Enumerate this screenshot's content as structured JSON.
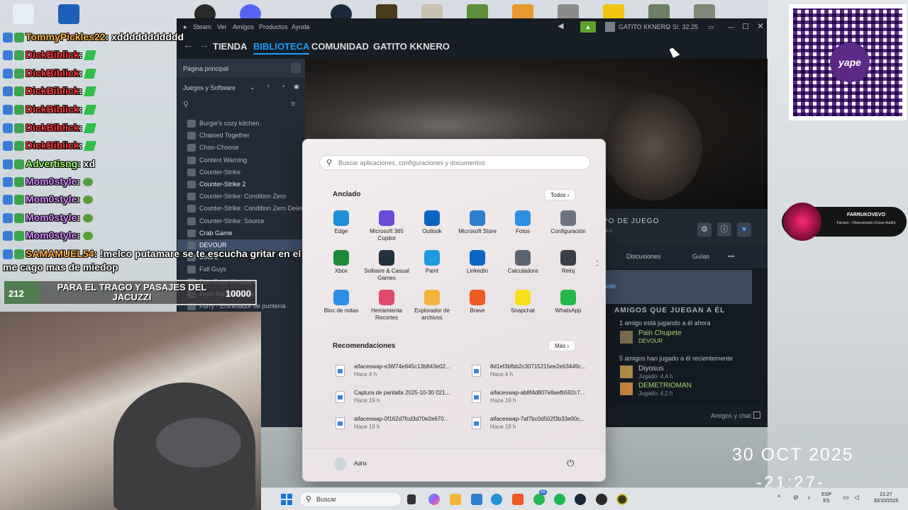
{
  "desktop_icons": [
    "Papelera de reciclaje",
    "Wallpaper Engine",
    "OBS",
    "Discord",
    "Steam",
    "Crab Game",
    "Minecraft",
    "Counter-Strike",
    "Rockstar",
    "GTA V"
  ],
  "chat": {
    "lines": [
      {
        "user": "TommyPickles22",
        "text": ": xddddddddddd",
        "color": "user-c"
      },
      {
        "user": "DickBiblick",
        "text": ":",
        "color": "user-a"
      },
      {
        "user": "DickBiblick",
        "text": ":",
        "color": "user-a"
      },
      {
        "user": "DickBiblick",
        "text": ":",
        "color": "user-a"
      },
      {
        "user": "DickBiblick",
        "text": ":",
        "color": "user-a"
      },
      {
        "user": "DickBiblick",
        "text": ":",
        "color": "user-a"
      },
      {
        "user": "DickBiblick",
        "text": ":",
        "color": "user-a"
      },
      {
        "user": "Advertisng",
        "text": ": xd",
        "color": "user-d"
      },
      {
        "user": "Mom0style",
        "text": ":",
        "color": "user-b"
      },
      {
        "user": "Mom0style",
        "text": ":",
        "color": "user-b"
      },
      {
        "user": "Mom0style",
        "text": ":",
        "color": "user-b"
      },
      {
        "user": "Mom0style",
        "text": ":",
        "color": "user-b"
      },
      {
        "user": "SAMAMUEL54",
        "text": ": !melco putamare se te escucha gritar en el juego, con eso",
        "color": "user-c"
      }
    ],
    "continuation": "me cago mas de miedop"
  },
  "goal": {
    "current": "212",
    "text": "PARA EL TRAGO Y PASAJES DEL JACUZZI",
    "target": "10000",
    "progress": 0.0212
  },
  "steam": {
    "menu": [
      "Steam",
      "Ver",
      "Amigos",
      "Productos",
      "Ayuda"
    ],
    "username": "GATITO KKNERO",
    "balance": "S/. 32.25",
    "tabs": [
      "TIENDA",
      "BIBLIOTECA",
      "COMUNIDAD",
      "GATITO KKNERO"
    ],
    "active_tab": "BIBLIOTECA",
    "home": "Página principal",
    "filter": "Juegos y Software",
    "games": [
      "Burgie's cozy kitchen",
      "Chained Together",
      "Choo-Choose",
      "Content Warning",
      "Counter-Strike",
      "Counter-Strike 2",
      "Counter-Strike: Condition Zero",
      "Counter-Strike: Condition Zero Deleted Scenes",
      "Counter-Strike: Source",
      "Crab Game",
      "DEVOUR",
      "Dota 2",
      "Fall Guys",
      "Fast Food Simulator",
      "From the Darkness",
      "Furry - Entrenador de puntería"
    ],
    "selected_game": "DEVOUR",
    "gametime_label": "PO DE JUEGO",
    "gametime_sub": "ras",
    "subnav": [
      "Discusiones",
      "Guías",
      "•••"
    ],
    "play_later": "arde",
    "friends_title": "AMIGOS QUE JUEGAN A ÉL",
    "friends_now": "1 amigo está jugando a él ahora",
    "friend1": {
      "name": "Pain Chupete",
      "status": "DEVOUR"
    },
    "friends_recent": "5 amigos han jugado a él recientemente",
    "friend2": {
      "name": "Diyosus",
      "status": "Jugado: 4,4 h"
    },
    "friend3": {
      "name": "DEMETRIOMAN",
      "status": "Jugado: 4,2 h"
    },
    "friends_chat": "Amigos y chat"
  },
  "start_menu": {
    "search_placeholder": "Buscar aplicaciones, configuraciones y documentos",
    "pinned_title": "Anclado",
    "all_button": "Todos",
    "apps": [
      {
        "label": "Edge",
        "icon": "edge-icon",
        "color": "#1f8fd6"
      },
      {
        "label": "Microsoft 365 Copilot",
        "icon": "m365-icon",
        "color": "#6c4ad8"
      },
      {
        "label": "Outlook",
        "icon": "outlook-icon",
        "color": "#0a66c2"
      },
      {
        "label": "Microsoft Store",
        "icon": "store-icon",
        "color": "#2f7fd1"
      },
      {
        "label": "Fotos",
        "icon": "photos-icon",
        "color": "#2d8fe0"
      },
      {
        "label": "Configuración",
        "icon": "settings-icon",
        "color": "#6d7480"
      },
      {
        "label": "Xbox",
        "icon": "xbox-icon",
        "color": "#1d8a3a"
      },
      {
        "label": "Solitaire & Casual Games",
        "icon": "solitaire-icon",
        "color": "#22303f"
      },
      {
        "label": "Paint",
        "icon": "paint-icon",
        "color": "#1b9be0"
      },
      {
        "label": "LinkedIn",
        "icon": "linkedin-icon",
        "color": "#0a66c2"
      },
      {
        "label": "Calculadora",
        "icon": "calculator-icon",
        "color": "#5c6470"
      },
      {
        "label": "Reloj",
        "icon": "clock-icon",
        "color": "#3a3f47"
      },
      {
        "label": "Bloc de notas",
        "icon": "notepad-icon",
        "color": "#2c8ee8"
      },
      {
        "label": "Herramienta Recortes",
        "icon": "snipping-icon",
        "color": "#e04a6a"
      },
      {
        "label": "Explorador de archivos",
        "icon": "folder-icon",
        "color": "#f2b53a"
      },
      {
        "label": "Brave",
        "icon": "brave-icon",
        "color": "#f05a24"
      },
      {
        "label": "Snapchat",
        "icon": "snapchat-icon",
        "color": "#f7e018"
      },
      {
        "label": "WhatsApp",
        "icon": "whatsapp-icon",
        "color": "#25b84c"
      }
    ],
    "rec_title": "Recomendaciones",
    "more_button": "Más",
    "recommendations": [
      {
        "name": "aifaceswap-e36f74e845c13b843e02...",
        "time": "Hace 4 h"
      },
      {
        "name": "8d1ef3bfbb2c30715215ee2e63449c...",
        "time": "Hace 4 h"
      },
      {
        "name": "Captura de pantalla 2025-10-30 021...",
        "time": "Hace 19 h"
      },
      {
        "name": "aifaceswap-ab8f4d807e8aefb592c7...",
        "time": "Hace 19 h"
      },
      {
        "name": "aifaceswap-0f162d7fcd3d70e2e670...",
        "time": "Hace 19 h"
      },
      {
        "name": "aifaceswap-7af7bc0d502f3b33e00c...",
        "time": "Hace 19 h"
      }
    ],
    "user": "Adrix"
  },
  "taskbar": {
    "search": "Buscar",
    "whatsapp_badge": "59",
    "lang_top": "ESP",
    "lang_bottom": "ES",
    "time": "21:27",
    "date": "30/10/2025"
  },
  "overlay": {
    "qr_brand": "yape",
    "music_artist": "FARRUKOVEVO",
    "music_title": "Farruko - Obsesionado (Cover Audio)",
    "clock_date": "30 OCT 2025",
    "clock_time": "-21:27-"
  }
}
